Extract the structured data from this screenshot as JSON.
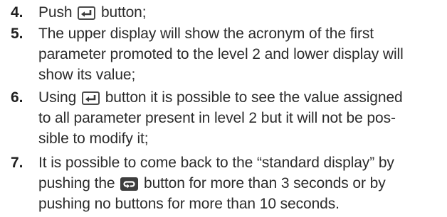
{
  "steps": [
    {
      "number": "4.",
      "lines": [
        {
          "before": "Push",
          "icon": "enter-key-icon",
          "after": "button;"
        }
      ]
    },
    {
      "number": "5.",
      "lines": [
        {
          "text": "The upper display will show the acronym of the first"
        },
        {
          "text": "parameter promoted to the level 2 and lower display will"
        },
        {
          "text": "show its value;"
        }
      ]
    },
    {
      "number": "6.",
      "lines": [
        {
          "before": "Using",
          "icon": "enter-key-icon",
          "after": "button it is possible to see the value assigned"
        },
        {
          "text": "to all parameter present in level 2 but it will not be pos-"
        },
        {
          "text": "sible to modify it;"
        }
      ]
    },
    {
      "number": "7.",
      "lines": [
        {
          "text": "It is possible to come back to the “standard display” by"
        },
        {
          "before": "pushing the",
          "icon": "loop-key-icon",
          "after": "button for more than 3 seconds or by"
        },
        {
          "text": "pushing no buttons for more than 10 seconds."
        }
      ]
    }
  ]
}
